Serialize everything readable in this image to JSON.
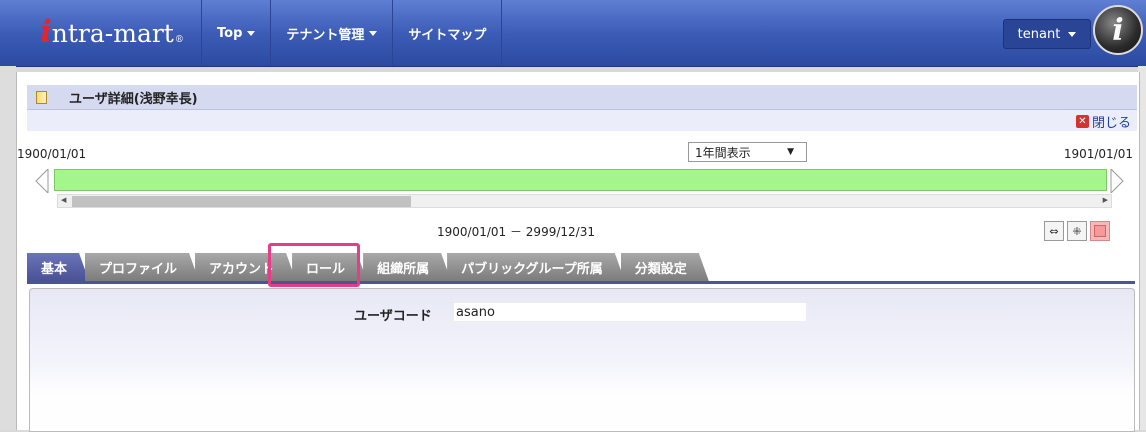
{
  "header": {
    "logo_text": "ntra-mart",
    "logo_mark": "i",
    "logo_reg": "®",
    "nav": [
      {
        "label": "Top"
      },
      {
        "label": "テナント管理"
      },
      {
        "label": "サイトマップ"
      }
    ],
    "tenant_label": "tenant",
    "avatar_letter": "i"
  },
  "page": {
    "title": "ユーザ詳細(浅野幸長)",
    "close_label": "閉じる",
    "date_start": "1900/01/01",
    "date_end": "1901/01/01",
    "period_select": "1年間表示",
    "range_text": "1900/01/01 － 2999/12/31",
    "timeline_fill_color": "#a4f58c",
    "tabs": [
      {
        "label": "基本",
        "active": true
      },
      {
        "label": "プロファイル",
        "active": false
      },
      {
        "label": "アカウント",
        "active": false
      },
      {
        "label": "ロール",
        "active": false
      },
      {
        "label": "組織所属",
        "active": false
      },
      {
        "label": "パブリックグループ所属",
        "active": false
      },
      {
        "label": "分類設定",
        "active": false
      }
    ],
    "highlighted_tab": "ロール",
    "highlight_color": "#e63c8a",
    "field": {
      "label": "ユーザコード",
      "value": "asano"
    }
  }
}
